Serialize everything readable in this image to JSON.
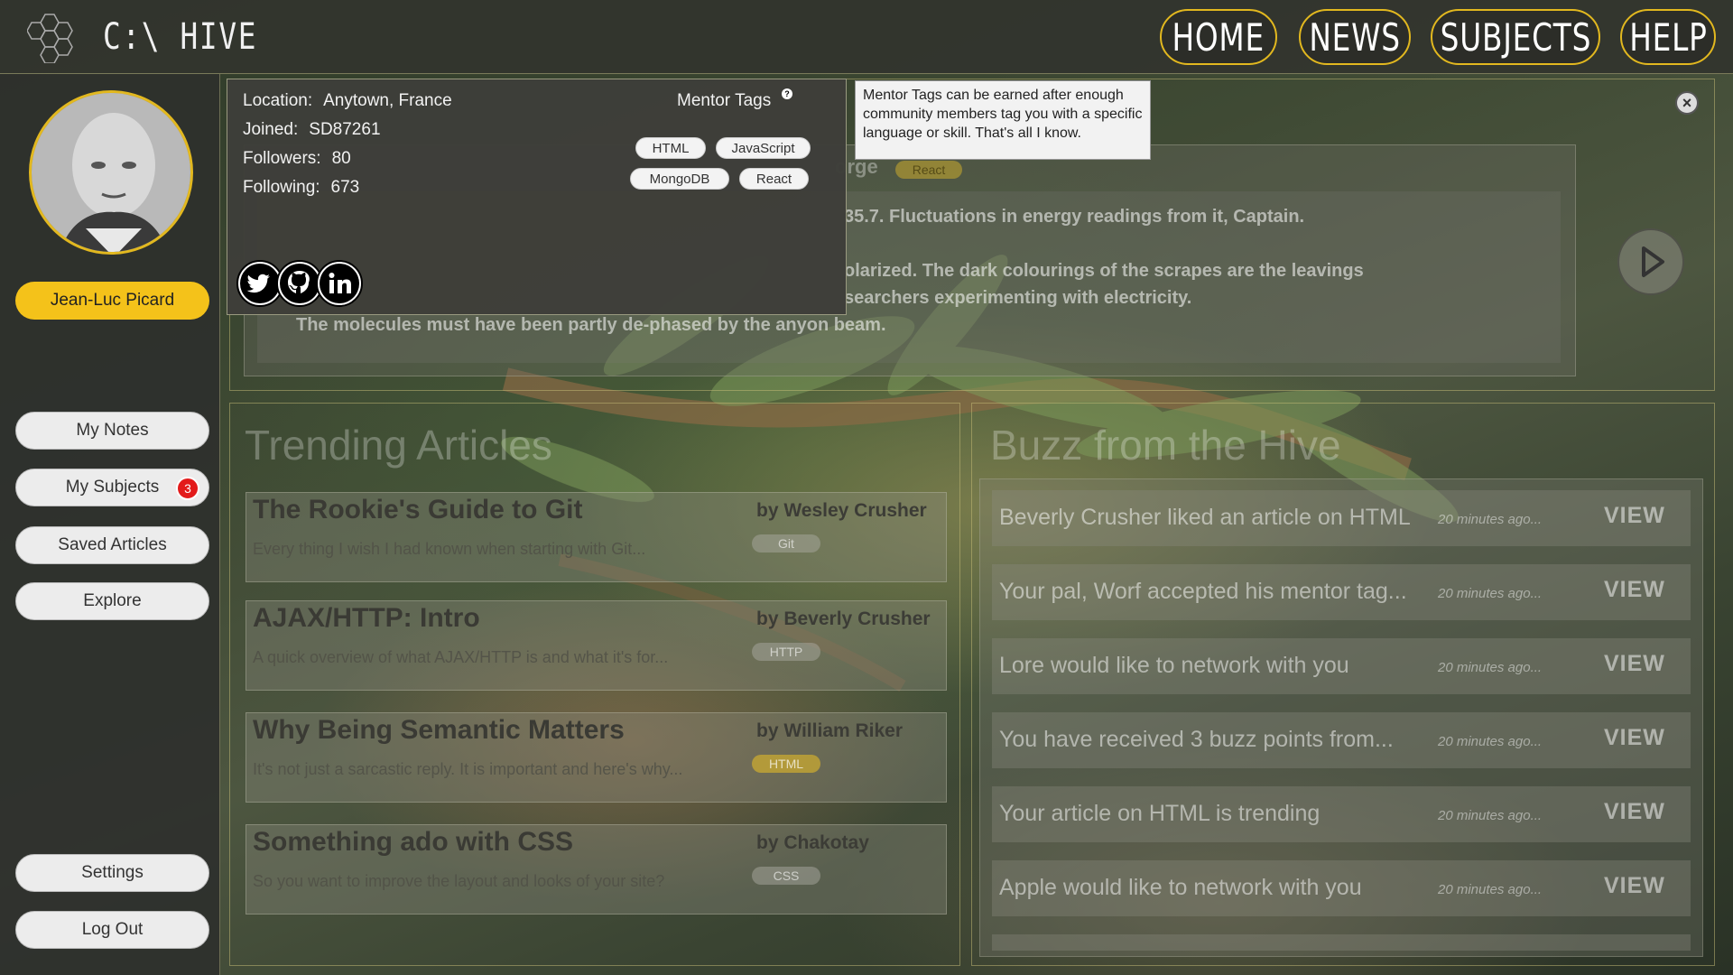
{
  "header": {
    "brand": "C:\\ HIVE",
    "nav": [
      "HOME",
      "NEWS",
      "SUBJECTS",
      "HELP"
    ]
  },
  "sidebar": {
    "user_name": "Jean-Luc Picard",
    "items": [
      {
        "label": "My Notes"
      },
      {
        "label": "My Subjects",
        "badge": "3"
      },
      {
        "label": "Saved Articles"
      },
      {
        "label": "Explore"
      }
    ],
    "bottom": [
      {
        "label": "Settings"
      },
      {
        "label": "Log Out"
      }
    ]
  },
  "profile": {
    "location_label": "Location:",
    "location": "Anytown, France",
    "joined_label": "Joined:",
    "joined": "SD87261",
    "followers_label": "Followers:",
    "followers": "80",
    "following_label": "Following:",
    "following": "673",
    "mentor_title": "Mentor Tags",
    "help_mark": "?",
    "tags": [
      "HTML",
      "JavaScript",
      "MongoDB",
      "React"
    ],
    "social": [
      "twitter-icon",
      "github-icon",
      "linkedin-icon"
    ],
    "tooltip": "Mentor Tags can be earned after enough community members tag you with a specific language or skill. That's all I know."
  },
  "featured": {
    "author": "orge",
    "tag": "React",
    "lines": [
      "35.7. Fluctuations in energy readings from it, Captain.",
      "olarized. The dark colourings of the scrapes are the leavings",
      "searchers experimenting with electricity.",
      "The molecules must have been partly de-phased by the anyon beam."
    ],
    "close": "×"
  },
  "trending": {
    "title": "Trending Articles",
    "articles": [
      {
        "title": "The Rookie's Guide to Git",
        "desc": "Every thing I wish I had known when starting with Git...",
        "author": "by Wesley Crusher",
        "tag": "Git",
        "tag_color": "gray"
      },
      {
        "title": "AJAX/HTTP: Intro",
        "desc": "A quick overview of what AJAX/HTTP is and what it's for...",
        "author": "by Beverly Crusher",
        "tag": "HTTP",
        "tag_color": "gray"
      },
      {
        "title": "Why Being Semantic Matters",
        "desc": "It's not just a sarcastic reply. It is important and here's why...",
        "author": "by William Riker",
        "tag": "HTML",
        "tag_color": "gold"
      },
      {
        "title": "Something ado with CSS",
        "desc": "So you want to improve the layout and looks of your site?",
        "author": "by Chakotay",
        "tag": "CSS",
        "tag_color": "gray"
      }
    ]
  },
  "buzz": {
    "title": "Buzz from the Hive",
    "items": [
      {
        "text": "Beverly Crusher liked an article on HTML",
        "time": "20 minutes ago...",
        "action": "VIEW"
      },
      {
        "text": "Your pal, Worf accepted his mentor tag...",
        "time": "20 minutes ago...",
        "action": "VIEW"
      },
      {
        "text": "Lore would like to network with you",
        "time": "20 minutes ago...",
        "action": "VIEW"
      },
      {
        "text": "You have received 3 buzz points from...",
        "time": "20 minutes ago...",
        "action": "VIEW"
      },
      {
        "text": "Your article on HTML is trending",
        "time": "20 minutes ago...",
        "action": "VIEW"
      },
      {
        "text": "Apple would like to network with you",
        "time": "20 minutes ago...",
        "action": "VIEW"
      }
    ]
  },
  "colors": {
    "accent": "#f4c21a",
    "badge": "#e31b1b"
  }
}
